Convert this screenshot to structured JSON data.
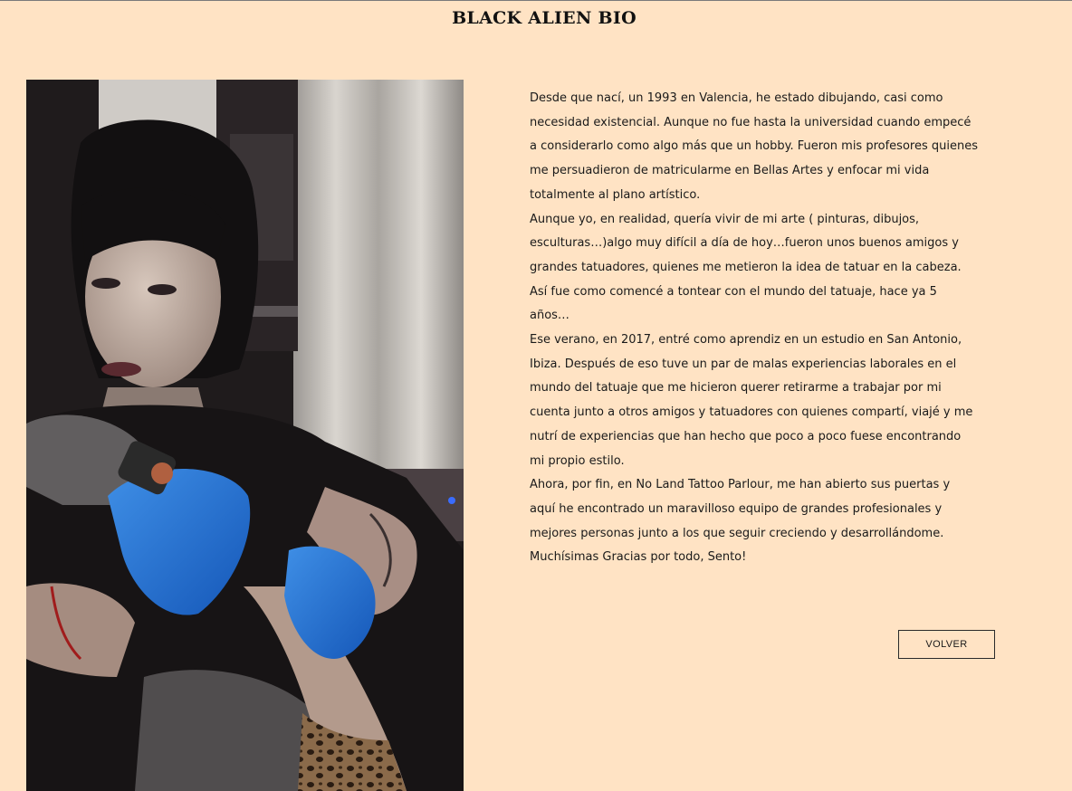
{
  "page": {
    "title": "BLACK ALIEN BIO"
  },
  "photo": {
    "alt": "Tattoo artist wearing blue gloves tattooing an arm"
  },
  "bio": {
    "paragraphs": [
      "Desde que nací, un 1993 en Valencia, he estado dibujando, casi como necesidad existencial. Aunque no fue hasta la universidad cuando empecé a considerarlo como algo más que un hobby. Fueron mis profesores quienes me persuadieron de matricularme en Bellas Artes y enfocar mi vida totalmente al plano artístico.",
      "Aunque yo, en realidad, quería vivir de mi arte ( pinturas, dibujos, esculturas…)algo muy difícil a día de hoy…fueron unos buenos amigos y grandes tatuadores, quienes me metieron la idea de tatuar en la cabeza.",
      "Así fue como comencé a tontear con el mundo del tatuaje, hace ya 5 años…",
      "Ese verano, en 2017, entré como aprendiz en un estudio en San Antonio, Ibiza. Después de eso tuve un par de malas experiencias laborales en el mundo del tatuaje que me hicieron querer retirarme a trabajar por mi cuenta junto a otros amigos y tatuadores con quienes compartí, viajé y me nutrí de experiencias que han hecho que poco a poco fuese encontrando mi propio estilo.",
      "Ahora, por fin, en No Land Tattoo Parlour, me han abierto sus puertas y aquí he encontrado un maravilloso equipo de grandes profesionales y mejores personas junto a los que seguir creciendo y desarrollándome.",
      "Muchísimas Gracias por todo, Sento!"
    ]
  },
  "actions": {
    "back_label": "VOLVER"
  }
}
